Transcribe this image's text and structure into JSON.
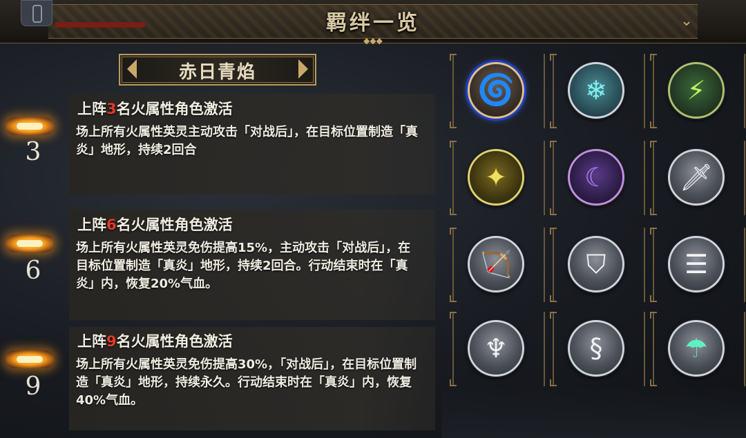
{
  "header": {
    "title": "羁绊一览"
  },
  "set": {
    "name": "赤日青焰"
  },
  "tiers": [
    {
      "count": "3",
      "head_prefix": "上阵",
      "head_num": "3",
      "head_suffix": "名火属性角色激活",
      "desc": "场上所有火属性英灵主动攻击「对战后」，在目标位置制造「真炎」地形，持续2回合"
    },
    {
      "count": "6",
      "head_prefix": "上阵",
      "head_num": "6",
      "head_suffix": "名火属性角色激活",
      "desc": "场上所有火属性英灵免伤提高15%，主动攻击「对战后」，在目标位置制造「真炎」地形，持续2回合。行动结束时在「真炎」内，恢复20%气血。"
    },
    {
      "count": "9",
      "head_prefix": "上阵",
      "head_num": "9",
      "head_suffix": "名火属性角色激活",
      "desc": "场上所有火属性英灵免伤提高30%，「对战后」，在目标位置制造「真炎」地形，持续永久。行动结束时在「真炎」内，恢复40%气血。"
    }
  ],
  "emblems": [
    {
      "name": "fire-element-icon",
      "glyph": "🌀",
      "style": "fire",
      "selected": true
    },
    {
      "name": "ice-element-icon",
      "glyph": "❄",
      "style": "ice",
      "selected": false
    },
    {
      "name": "thunder-element-icon",
      "glyph": "⚡",
      "style": "thunder",
      "selected": false
    },
    {
      "name": "light-element-icon",
      "glyph": "✦",
      "style": "light",
      "selected": false
    },
    {
      "name": "dark-element-icon",
      "glyph": "☾",
      "style": "dark",
      "selected": false
    },
    {
      "name": "sword-icon",
      "glyph": "🗡",
      "style": "",
      "selected": false
    },
    {
      "name": "bow-icon",
      "glyph": "🏹",
      "style": "",
      "selected": false
    },
    {
      "name": "shield-icon",
      "glyph": "⛉",
      "style": "",
      "selected": false
    },
    {
      "name": "claw-icon",
      "glyph": "☰",
      "style": "",
      "selected": false
    },
    {
      "name": "gourd-icon",
      "glyph": "♆",
      "style": "",
      "selected": false
    },
    {
      "name": "serpent-icon",
      "glyph": "§",
      "style": "",
      "selected": false
    },
    {
      "name": "wind-element-icon",
      "glyph": "☂",
      "style": "wind",
      "selected": false
    }
  ],
  "colors": {
    "accent_red": "#e23a2a",
    "selected_ring": "#3a6cff",
    "gold": "#c9a96a"
  }
}
